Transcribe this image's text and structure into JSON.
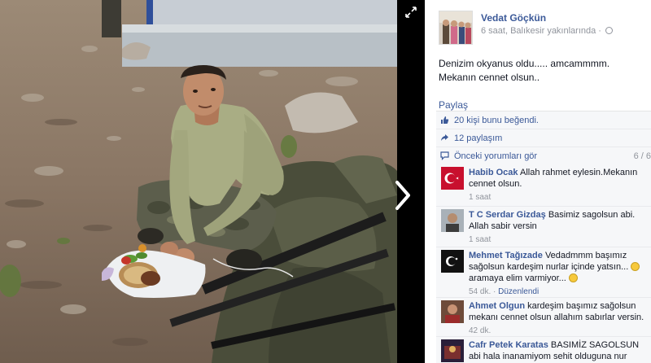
{
  "viewer": {
    "expand_icon": "expand-icon",
    "next_icon": "chevron-right-icon"
  },
  "post": {
    "author": "Vedat Göçkün",
    "meta": "6 saat, Balıkesir yakınlarında ·",
    "privacy_icon": "globe-icon",
    "caption": "Denizim okyanus oldu..... amcammmm. Mekanın cennet olsun..",
    "share_label": "Paylaş",
    "likes": "20 kişi bunu beğendi.",
    "shares": "12 paylaşım",
    "previous_comments": "Önceki yorumları gör",
    "comment_count": "6 / 6"
  },
  "comments": [
    {
      "name": "Habib Ocak",
      "text": "Allah rahmet eylesin.Mekanın cennet olsun.",
      "time": "1 saat",
      "edit": ""
    },
    {
      "name": "T C Serdar Gizdaş",
      "text": "Basimiz sagolsun abi. Allah sabir versin",
      "time": "1 saat",
      "edit": ""
    },
    {
      "name": "Mehmet Tağızade",
      "text": "Vedadmmm başımız sağolsun kardeşim nurlar içinde yatsın...",
      "text2": "aramaya elim varmiyor...",
      "time": "54 dk. · ",
      "edit": "Düzenlendi"
    },
    {
      "name": "Ahmet Olgun",
      "text": "kardeşim başımız sağolsun mekanı cennet olsun allahım sabırlar versin.",
      "time": "42 dk.",
      "edit": ""
    },
    {
      "name": "Cafr Petek Karatas",
      "text": "BASIMİZ SAGOLSUN abi hala inanamiyom sehit olduguna nur icinde",
      "time": "",
      "edit": ""
    }
  ],
  "colors": {
    "link": "#3b5998",
    "muted": "#90949c",
    "ufi_bg": "#f6f7f9"
  }
}
